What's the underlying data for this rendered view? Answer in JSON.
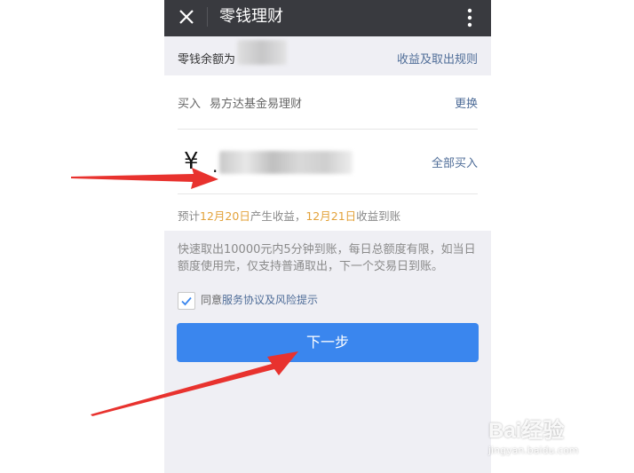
{
  "topbar": {
    "title": "零钱理财",
    "close_icon": "close-icon",
    "more_icon": "more-vertical-icon"
  },
  "balance": {
    "label": "零钱余额为",
    "rules_link": "收益及取出规则"
  },
  "purchase": {
    "buy_label": "买入",
    "fund_name": "易方达基金易理财",
    "change_label": "更换",
    "currency_symbol": "¥",
    "buy_all_label": "全部买入",
    "estimate_prefix": "预计",
    "income_date": "12月20日",
    "estimate_mid": "产生收益，",
    "arrival_date": "12月21日",
    "estimate_suffix": "收益到账"
  },
  "notice": {
    "text": "快速取出10000元内5分钟到账，每日总额度有限，如当日额度使用完，仅支持普通取出，下一个交易日到账。"
  },
  "agreement": {
    "checked": true,
    "prefix": "同意",
    "link": "服务协议及风险提示"
  },
  "next_button": {
    "label": "下一步"
  },
  "watermark": {
    "brand": "Bai经验",
    "url": "jingyan.baidu.com"
  },
  "colors": {
    "topbar_bg": "#393a3f",
    "link": "#4f6d98",
    "highlight": "#e3a23a",
    "button": "#3a86ee",
    "arrow": "#e8322e"
  }
}
